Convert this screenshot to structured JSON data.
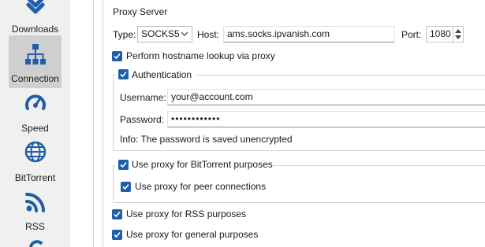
{
  "sidebar": {
    "items": [
      {
        "label": "Downloads",
        "icon": "chevron-down-icon"
      },
      {
        "label": "Connection",
        "icon": "network-icon",
        "selected": true
      },
      {
        "label": "Speed",
        "icon": "speedometer-icon"
      },
      {
        "label": "BitTorrent",
        "icon": "globe-icon"
      },
      {
        "label": "RSS",
        "icon": "rss-icon"
      }
    ]
  },
  "proxy": {
    "group_title": "Proxy Server",
    "type_label": "Type:",
    "type_value": "SOCKS5",
    "host_label": "Host:",
    "host_value": "ams.socks.ipvanish.com",
    "port_label": "Port:",
    "port_value": "1080",
    "hostname_lookup_label": "Perform hostname lookup via proxy",
    "auth_label": "Authentication",
    "username_label": "Username:",
    "username_value": "your@account.com",
    "password_label": "Password:",
    "password_value": "••••••••••••",
    "info_text": "Info: The password is saved unencrypted",
    "bittorrent_label": "Use proxy for BitTorrent purposes",
    "peer_label": "Use proxy for peer connections",
    "rss_label": "Use proxy for RSS purposes",
    "general_label": "Use proxy for general purposes"
  },
  "colors": {
    "accent": "#1f5fa8",
    "selected_bg": "#cfcfcf",
    "sidebar_bg": "#f0f0f0"
  }
}
